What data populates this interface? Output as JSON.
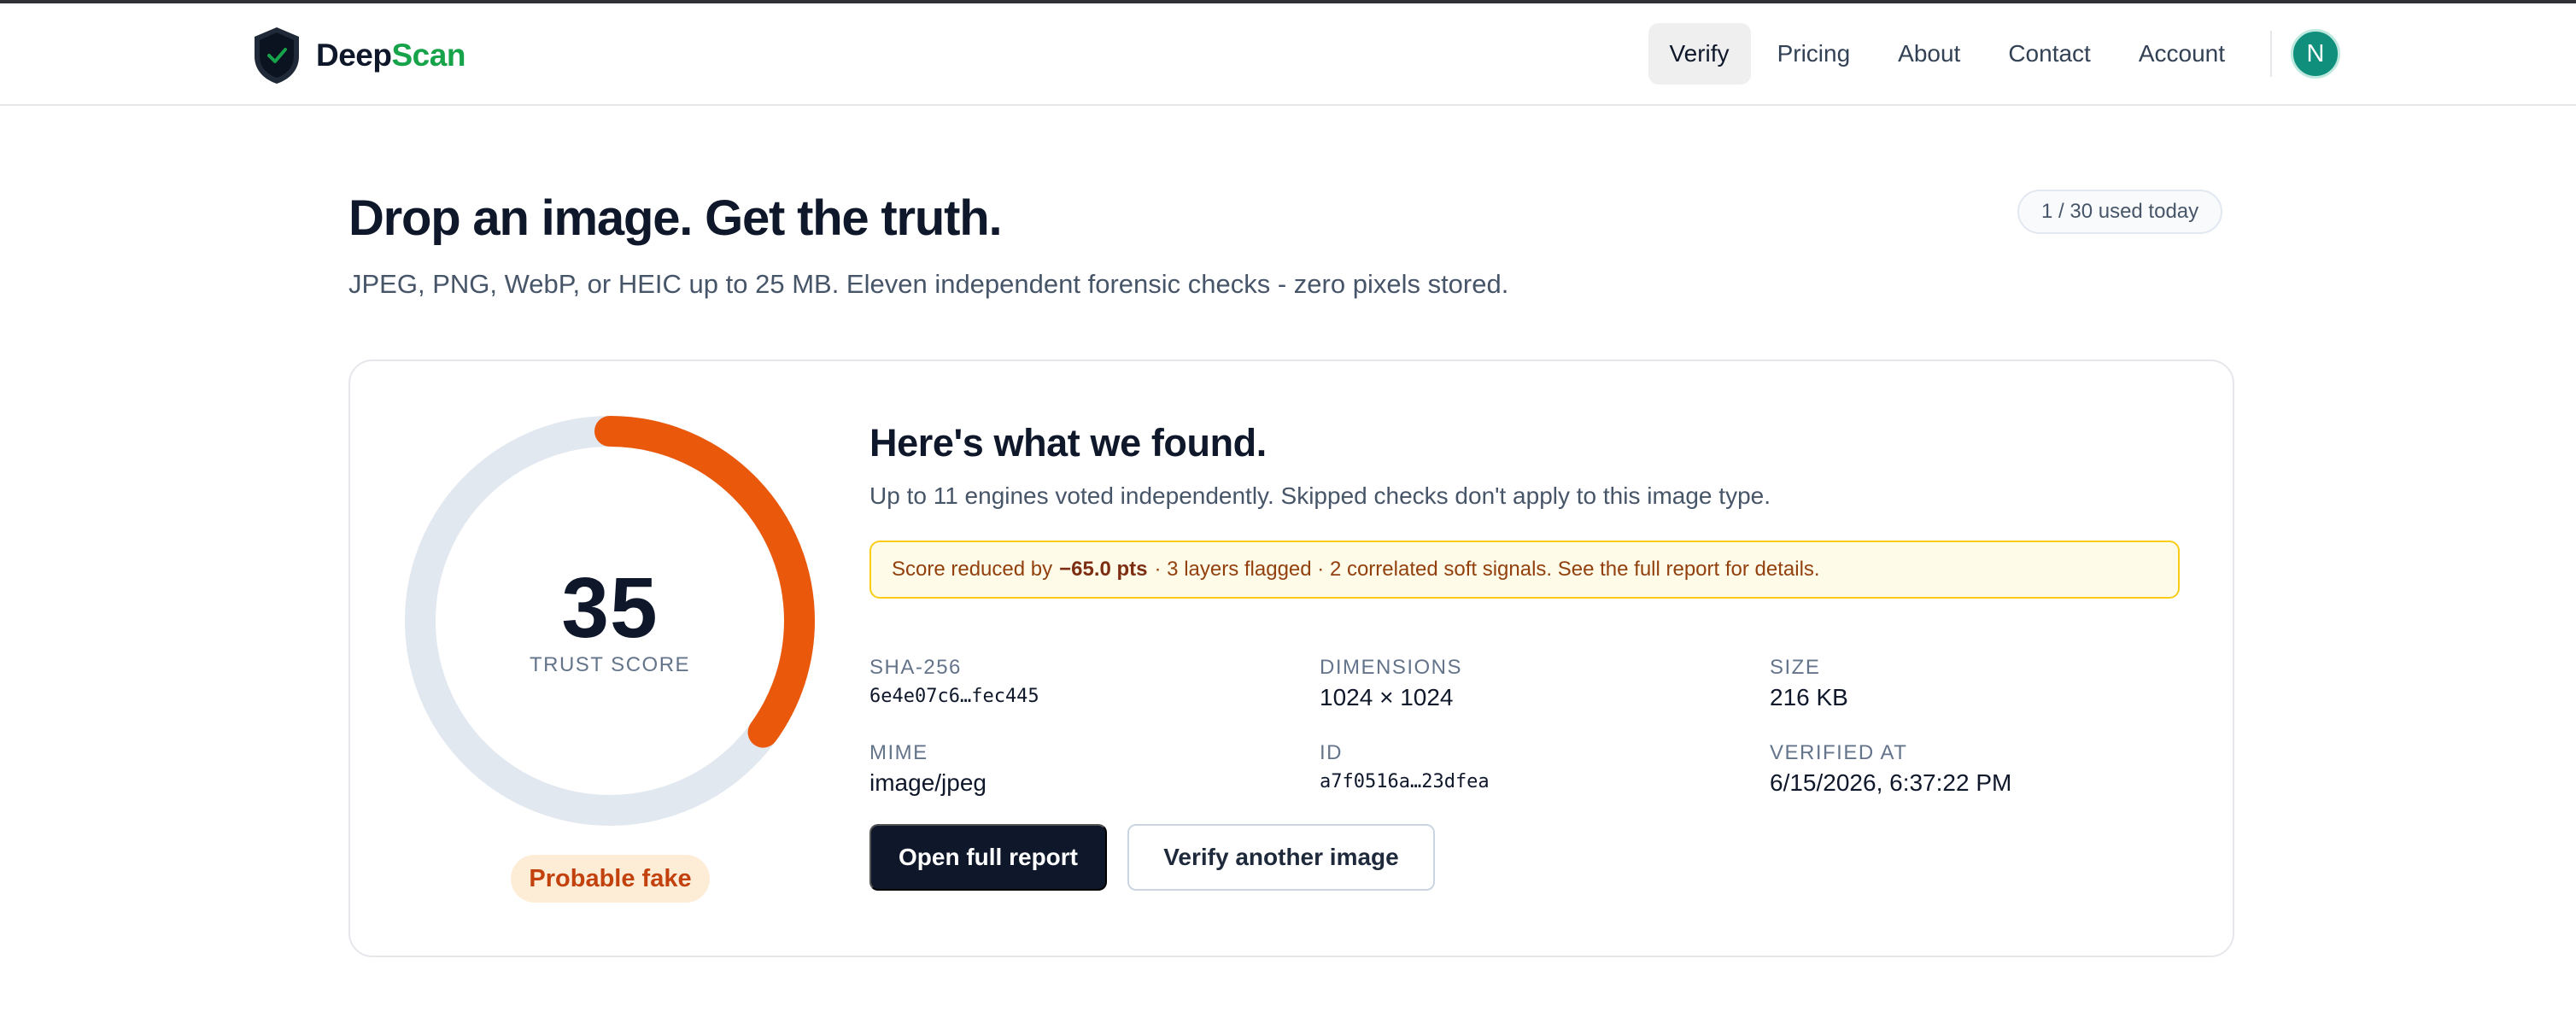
{
  "header": {
    "brand_part1": "Deep",
    "brand_part2": "Scan",
    "nav": [
      {
        "label": "Verify",
        "active": true
      },
      {
        "label": "Pricing"
      },
      {
        "label": "About"
      },
      {
        "label": "Contact"
      },
      {
        "label": "Account"
      }
    ],
    "avatar_initial": "N"
  },
  "main": {
    "title": "Drop an image. Get the truth.",
    "subtitle": "JPEG, PNG, WebP, or HEIC up to 25 MB. Eleven independent forensic checks - zero pixels stored.",
    "usage_badge": "1 / 30 used today"
  },
  "result": {
    "score": "35",
    "score_value": 35,
    "score_max": 100,
    "score_label": "TRUST SCORE",
    "verdict": "Probable fake",
    "title": "Here's what we found.",
    "subtitle": "Up to 11 engines voted independently. Skipped checks don't apply to this image type.",
    "alert_prefix": "Score reduced by",
    "alert_bold": "−65.0 pts",
    "alert_suffix": "· 3 layers flagged · 2 correlated soft signals. See the full report for details.",
    "meta": {
      "sha_label": "SHA-256",
      "sha_value": "6e4e07c6…fec445",
      "dimensions_label": "DIMENSIONS",
      "dimensions_value": "1024 × 1024",
      "size_label": "SIZE",
      "size_value": "216 KB",
      "mime_label": "MIME",
      "mime_value": "image/jpeg",
      "id_label": "ID",
      "id_value": "a7f0516a…23dfea",
      "verified_label": "VERIFIED AT",
      "verified_value": "6/15/2026, 6:37:22 PM"
    },
    "primary_button": "Open full report",
    "secondary_button": "Verify another image"
  },
  "colors": {
    "brand_green": "#16a34a",
    "gauge_fill": "#ea580c",
    "gauge_track": "#e2e8f0",
    "avatar_bg": "#0f8f7c",
    "alert_bg": "#fefce8",
    "alert_border": "#facc15"
  },
  "icons": {
    "logo": "shield-check-icon"
  }
}
